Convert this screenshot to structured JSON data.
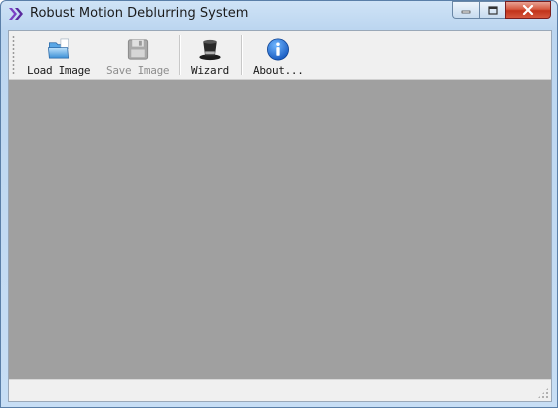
{
  "window": {
    "title": "Robust Motion Deblurring System",
    "icon": "double-chevron-purple-icon"
  },
  "toolbar": {
    "items": [
      {
        "label": "Load Image",
        "icon": "open-folder-icon",
        "enabled": true
      },
      {
        "label": "Save Image",
        "icon": "floppy-disk-icon",
        "enabled": false
      },
      {
        "label": "Wizard",
        "icon": "magic-hat-icon",
        "enabled": true
      },
      {
        "label": "About...",
        "icon": "info-icon",
        "enabled": true
      }
    ]
  },
  "canvas": {
    "background": "#a0a0a0"
  },
  "statusbar": {
    "text": ""
  }
}
